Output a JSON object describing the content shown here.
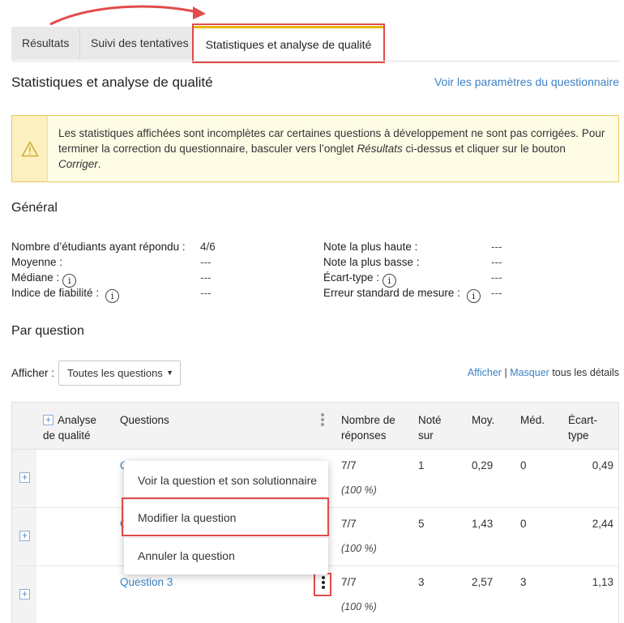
{
  "tabs": [
    {
      "label": "Résultats"
    },
    {
      "label": "Suivi des tentatives"
    },
    {
      "label": "Statistiques et analyse de qualité"
    }
  ],
  "page_title": "Statistiques et analyse de qualité",
  "params_link": "Voir les paramètres du questionnaire",
  "warning": {
    "part1": "Les statistiques affichées sont incomplètes car certaines questions à développement ne sont pas corrigées. Pour terminer la correction du questionnaire, basculer vers l’onglet ",
    "results_word": "Résultats",
    "part2": " ci-dessus et cliquer sur le bouton ",
    "correct_word": "Corriger",
    "part3": "."
  },
  "general": {
    "title": "Général",
    "left": [
      {
        "label": "Nombre d’étudiants ayant répondu :",
        "value": "4/6"
      },
      {
        "label": "Moyenne :",
        "value": "---"
      },
      {
        "label": "Médiane :",
        "value": "---"
      },
      {
        "label": "Indice de fiabilité :",
        "value": "---"
      }
    ],
    "right": [
      {
        "label": "Note la plus haute :",
        "value": "---"
      },
      {
        "label": "Note la plus basse :",
        "value": "---"
      },
      {
        "label": "Écart-type :",
        "value": "---"
      },
      {
        "label": "Erreur standard de mesure :",
        "value": "---"
      }
    ]
  },
  "per_question": {
    "title": "Par question",
    "filter_label": "Afficher :",
    "filter_value": "Toutes les questions",
    "show": "Afficher",
    "sep": "|",
    "hide": "Masquer",
    "details": "tous les détails"
  },
  "table": {
    "headers": {
      "quality_line1": "Analyse",
      "quality_line2": "de qualité",
      "questions": "Questions",
      "responses_line1": "Nombre de",
      "responses_line2": "réponses",
      "out_of_line1": "Noté",
      "out_of_line2": "sur",
      "mean": "Moy.",
      "median": "Méd.",
      "sd_line1": "Écart-",
      "sd_line2": "type"
    },
    "rows": [
      {
        "question": "Q",
        "responses": "7/7",
        "pct": "(100 %)",
        "out_of": "1",
        "mean": "0,29",
        "median": "0",
        "sd": "0,49"
      },
      {
        "question": "Q",
        "responses": "7/7",
        "pct": "(100 %)",
        "out_of": "5",
        "mean": "1,43",
        "median": "0",
        "sd": "2,44"
      },
      {
        "question": "Question 3",
        "responses": "7/7",
        "pct": "(100 %)",
        "out_of": "3",
        "mean": "2,57",
        "median": "3",
        "sd": "1,13"
      }
    ]
  },
  "menu": {
    "items": [
      {
        "label": "Voir la question et son solutionnaire"
      },
      {
        "label": "Modifier la question"
      },
      {
        "label": "Annuler la question"
      }
    ]
  }
}
